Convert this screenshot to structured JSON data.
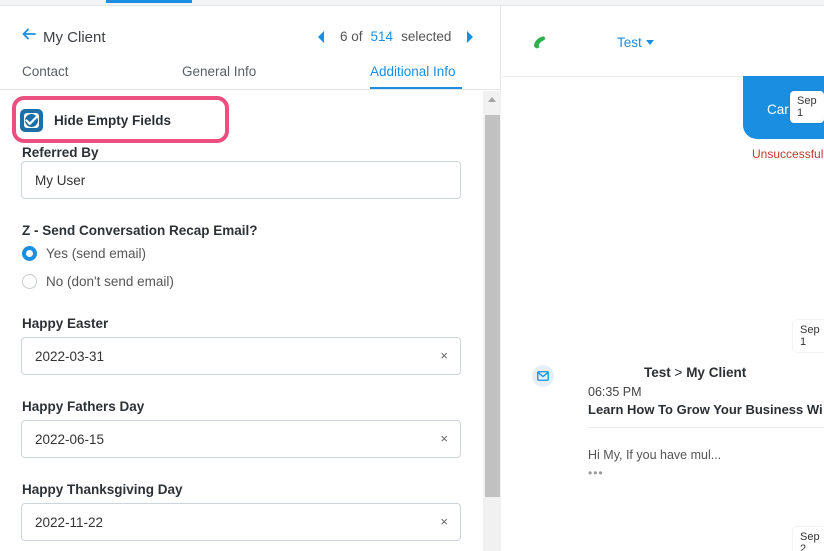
{
  "left_panel": {
    "header": {
      "title": "My Client",
      "pager_position": "6 of",
      "pager_total": "514",
      "pager_selected": "selected"
    },
    "tabs": [
      "Contact",
      "General Info",
      "Additional Info"
    ],
    "hide_empty": {
      "label": "Hide Empty Fields",
      "checked": true
    },
    "fields": {
      "referred_by": {
        "label": "Referred By",
        "value": "My User"
      },
      "recap": {
        "label": "Z - Send Conversation Recap Email?",
        "options": [
          "Yes (send email)",
          "No (don't send email)"
        ],
        "selected": "Yes (send email)"
      },
      "easter": {
        "label": "Happy Easter",
        "value": "2022-03-31",
        "clear": "×"
      },
      "fathers": {
        "label": "Happy Fathers Day",
        "value": "2022-06-15",
        "clear": "×"
      },
      "thanksgiving": {
        "label": "Happy Thanksgiving Day",
        "value": "2022-11-22",
        "clear": "×"
      }
    }
  },
  "right_panel": {
    "contact_dropdown": "Test",
    "bubble_text": "Car",
    "date_pills": [
      "Sep 1",
      "Sep 1",
      "Sep 2"
    ],
    "status_text": "Unsuccessful",
    "message": {
      "from": "Test",
      "separator": ">",
      "to": "My Client",
      "time": "06:35 PM",
      "subject": "Learn How To Grow Your Business Wi",
      "preview": "Hi My,  If you have mul...",
      "more": "•••"
    }
  },
  "colors": {
    "accent": "#1a8ee1",
    "highlight": "#ec4f7f",
    "error": "#c0392b",
    "phone": "#2bb24c"
  }
}
